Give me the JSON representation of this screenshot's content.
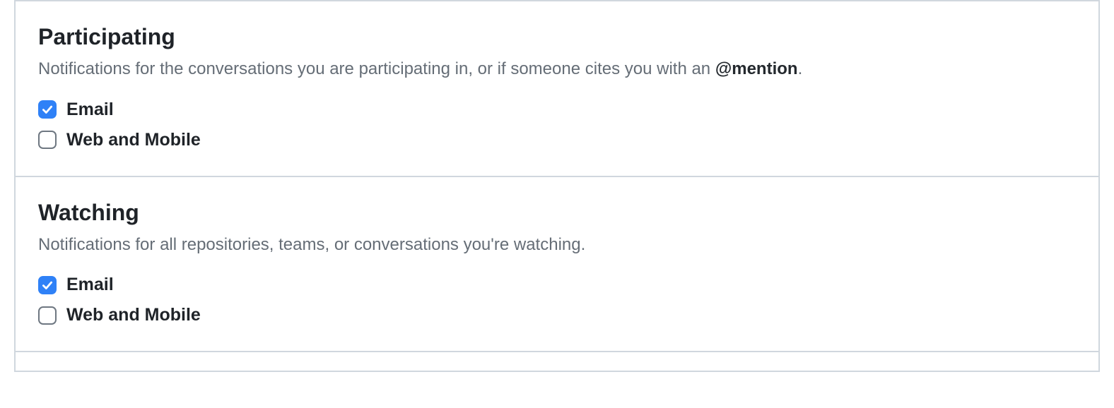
{
  "sections": {
    "participating": {
      "title": "Participating",
      "description_prefix": "Notifications for the conversations you are participating in, or if someone cites you with an ",
      "description_mention": "@mention",
      "description_suffix": ".",
      "options": {
        "email": {
          "label": "Email",
          "checked": true
        },
        "web": {
          "label": "Web and Mobile",
          "checked": false
        }
      }
    },
    "watching": {
      "title": "Watching",
      "description": "Notifications for all repositories, teams, or conversations you're watching.",
      "options": {
        "email": {
          "label": "Email",
          "checked": true
        },
        "web": {
          "label": "Web and Mobile",
          "checked": false
        }
      }
    }
  }
}
